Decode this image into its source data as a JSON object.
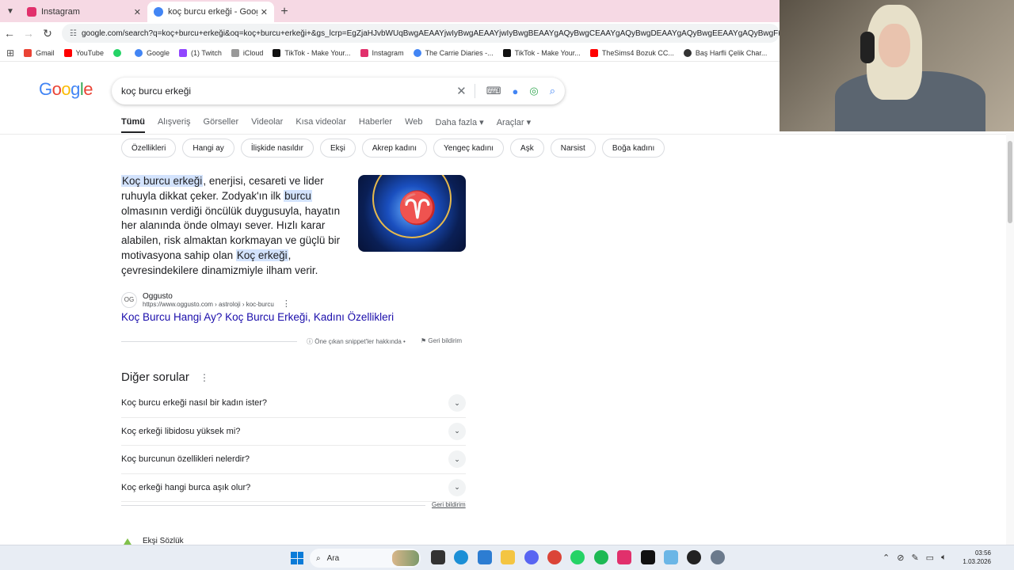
{
  "browser": {
    "tabs": [
      {
        "title": "Instagram",
        "color": "#e1306c"
      },
      {
        "title": "koç burcu erkeği - Google'da Ara",
        "color": "#4285f4"
      }
    ],
    "url": "google.com/search?q=koç+burcu+erkeği&oq=koç+burcu+erkeği+&gs_lcrp=EgZjaHJvbWUqBwgAEAAYjwIyBwgAEAAYjwIyBwgBEAAYgAQyBwgCEAAYgAQyBwgDEAAYgAQyBwgEEAAYgAQyBwgFEAAYgAQyBwgGEAAYgAQ",
    "bookmarks": [
      {
        "label": "Gmail",
        "color": "#ea4335"
      },
      {
        "label": "YouTube",
        "color": "#ff0000"
      },
      {
        "label": "",
        "color": "#25d366"
      },
      {
        "label": "Google",
        "color": "#4285f4"
      },
      {
        "label": "(1) Twitch",
        "color": "#9146ff"
      },
      {
        "label": "iCloud",
        "color": "#999999"
      },
      {
        "label": "TikTok - Make Your...",
        "color": "#111111"
      },
      {
        "label": "Instagram",
        "color": "#e1306c"
      },
      {
        "label": "The Carrie Diaries -...",
        "color": "#4285f4"
      },
      {
        "label": "TikTok - Make Your...",
        "color": "#111111"
      },
      {
        "label": "TheSims4 Bozuk CC...",
        "color": "#ff0000"
      },
      {
        "label": "Baş Harfli Çelik Char...",
        "color": "#333333"
      }
    ]
  },
  "google": {
    "logo": "Google",
    "query": "koç burcu erkeği",
    "nav_tabs": [
      "Tümü",
      "Alışveriş",
      "Görseller",
      "Videolar",
      "Kısa videolar",
      "Haberler",
      "Web",
      "Daha fazla ▾",
      "Araçlar ▾"
    ],
    "chips": [
      "Özellikleri",
      "Hangi ay",
      "İlişkide nasıldır",
      "Ekşi",
      "Akrep kadını",
      "Yengeç kadını",
      "Aşk",
      "Narsist",
      "Boğa kadını"
    ]
  },
  "snippet": {
    "hl1": "Koç burcu erkeği",
    "t1": ", enerjisi, cesareti ve lider ruhuyla dikkat çeker. Zodyak'ın ilk ",
    "hl2": "burcu",
    "t2": " olmasının verdiği öncülük duygusuyla, hayatın her alanında önde olmayı sever. Hızlı karar alabilen, risk almaktan korkmayan ve güçlü bir motivasyona sahip olan ",
    "hl3": "Koç erkeği",
    "t3": ", çevresindekilere dinamizmiyle ilham verir.",
    "source_logo": "OG",
    "source_name": "Oggusto",
    "source_url": "https://www.oggusto.com › astroloji › koc-burcu",
    "title": "Koç Burcu Hangi Ay? Koç Burcu Erkeği, Kadını Özellikleri",
    "about": "Öne çıkan snippet'ler hakkında",
    "feedback": "Geri bildirim"
  },
  "paa": {
    "title": "Diğer sorular",
    "questions": [
      "Koç burcu erkeği nasıl bir kadın ister?",
      "Koç erkeği libidosu yüksek mi?",
      "Koç burcunun özellikleri nelerdir?",
      "Koç erkeği hangi burca aşık olur?"
    ],
    "feedback": "Geri bildirim"
  },
  "next_result": {
    "source": "Ekşi Sözlük"
  },
  "taskbar": {
    "search_placeholder": "Ara",
    "time": "03:56",
    "date": "1.03.2026",
    "apps": [
      {
        "name": "task-view",
        "color": "#333333"
      },
      {
        "name": "edge",
        "color": "#1b8fd6"
      },
      {
        "name": "notepad",
        "color": "#2d7dd2"
      },
      {
        "name": "explorer",
        "color": "#f4c542"
      },
      {
        "name": "discord",
        "color": "#5865f2"
      },
      {
        "name": "chrome",
        "color": "#db4437"
      },
      {
        "name": "whatsapp",
        "color": "#25d366"
      },
      {
        "name": "spotify",
        "color": "#1db954"
      },
      {
        "name": "instagram",
        "color": "#e1306c"
      },
      {
        "name": "tiktok",
        "color": "#111111"
      },
      {
        "name": "app",
        "color": "#6bb6e6"
      },
      {
        "name": "app2",
        "color": "#222222"
      },
      {
        "name": "settings",
        "color": "#6b7a8c"
      }
    ]
  }
}
